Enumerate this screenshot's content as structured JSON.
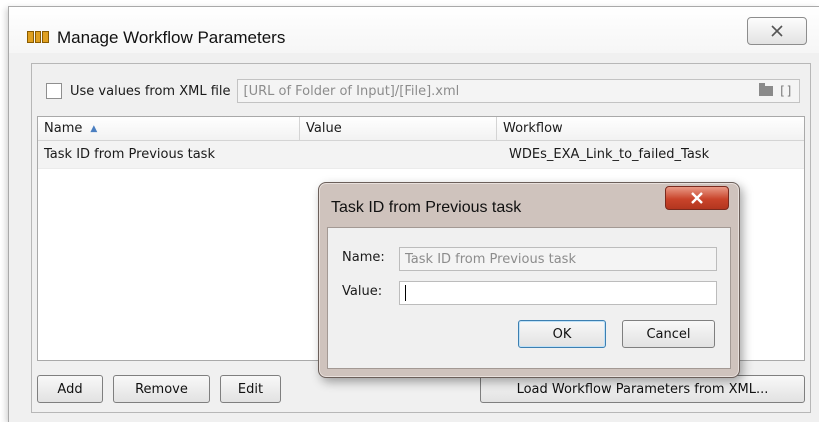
{
  "window": {
    "title": "Manage Workflow Parameters",
    "close_glyph": "✕",
    "app_icon": "parameter-table-icon"
  },
  "xml_source": {
    "checkbox_label": "Use values from XML file",
    "checked": false,
    "placeholder": "[URL of Folder of Input]/[File].xml",
    "folder_icon": "folder-icon",
    "bracket_glyph": "[]"
  },
  "table": {
    "columns": [
      "Name",
      "Value",
      "Workflow"
    ],
    "sort_column": "Name",
    "sort_glyph": "▲",
    "rows": [
      {
        "name": "Task ID from Previous task",
        "value": "",
        "workflow": "WDEs_EXA_Link_to_failed_Task"
      }
    ]
  },
  "buttons": {
    "add": "Add",
    "remove": "Remove",
    "edit": "Edit",
    "load": "Load Workflow Parameters from XML..."
  },
  "dialog": {
    "title": "Task ID from Previous task",
    "close_glyph": "X",
    "name_label": "Name:",
    "name_value": "Task ID from Previous task",
    "value_label": "Value:",
    "value_value": "",
    "ok": "OK",
    "cancel": "Cancel"
  },
  "colors": {
    "dialog_close": "#c9442b",
    "dialog_frame": "#cfc3bd",
    "sort_arrow": "#4a7ec0"
  }
}
